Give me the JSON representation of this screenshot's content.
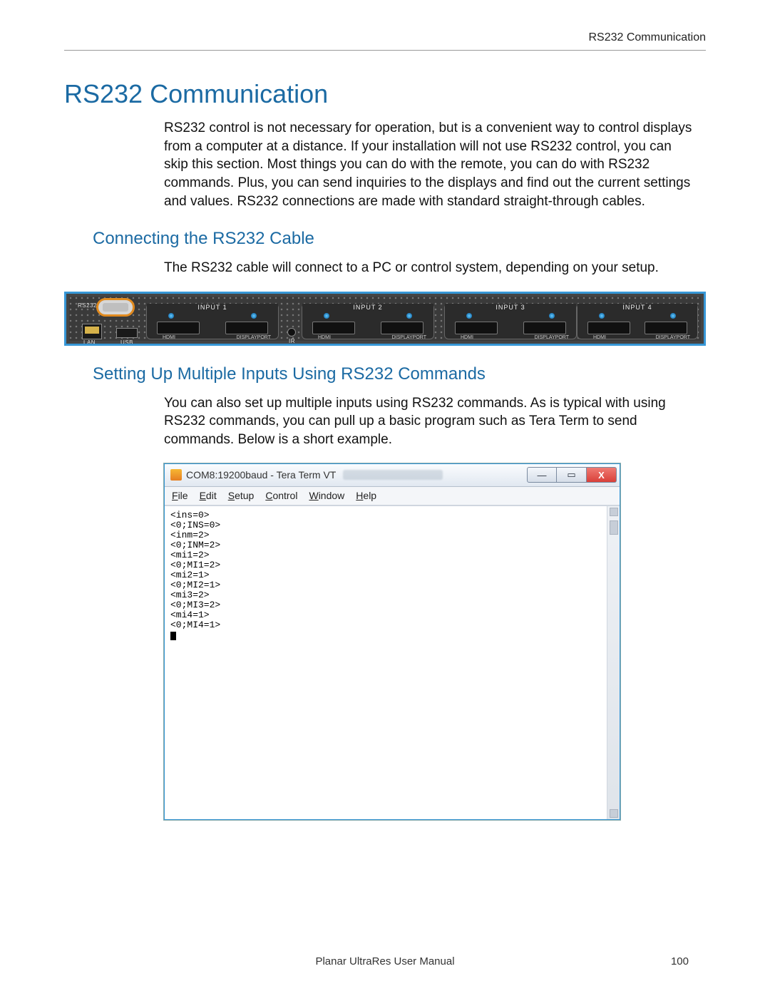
{
  "header": {
    "running": "RS232 Communication"
  },
  "h1": "RS232 Communication",
  "intro": "RS232 control is not necessary for operation, but is a convenient way to control displays from a computer at a distance. If your installation will not use RS232 control, you can skip this section. Most things you can do with the remote, you can do with RS232 commands. Plus, you can send inquiries to the displays and find out the current settings and values. RS232 connections are made with standard straight-through cables.",
  "section1": {
    "heading": "Connecting the RS232 Cable",
    "body": "The RS232 cable will connect to a PC or control system, depending on your setup."
  },
  "device": {
    "ports": {
      "rs232": "RS232",
      "lan": "LAN",
      "usb": "USB",
      "ir": "IR"
    },
    "inputs": [
      {
        "label": "INPUT 1",
        "p1": "HDMI",
        "p2": "DISPLAYPORT"
      },
      {
        "label": "INPUT 2",
        "p1": "HDMI",
        "p2": "DISPLAYPORT"
      },
      {
        "label": "INPUT 3",
        "p1": "HDMI",
        "p2": "DISPLAYPORT"
      },
      {
        "label": "INPUT 4",
        "p1": "HDMI",
        "p2": "DISPLAYPORT"
      }
    ]
  },
  "section2": {
    "heading": "Setting Up Multiple Inputs Using RS232 Commands",
    "body": "You can also set up multiple inputs using RS232 commands. As is typical with using RS232 commands, you can pull up a basic program such as Tera Term to send commands. Below is a short example."
  },
  "teraterm": {
    "title": "COM8:19200baud - Tera Term VT",
    "menu": [
      "File",
      "Edit",
      "Setup",
      "Control",
      "Window",
      "Help"
    ],
    "winbtns": {
      "min": "—",
      "max": "▭",
      "close": "X"
    },
    "lines": [
      "<ins=0>",
      "<0;INS=0>",
      "<inm=2>",
      "<0;INM=2>",
      "<mi1=2>",
      "<0;MI1=2>",
      "<mi2=1>",
      "<0;MI2=1>",
      "<mi3=2>",
      "<0;MI3=2>",
      "<mi4=1>",
      "<0;MI4=1>"
    ]
  },
  "footer": {
    "manual": "Planar UltraRes User Manual",
    "page": "100"
  }
}
